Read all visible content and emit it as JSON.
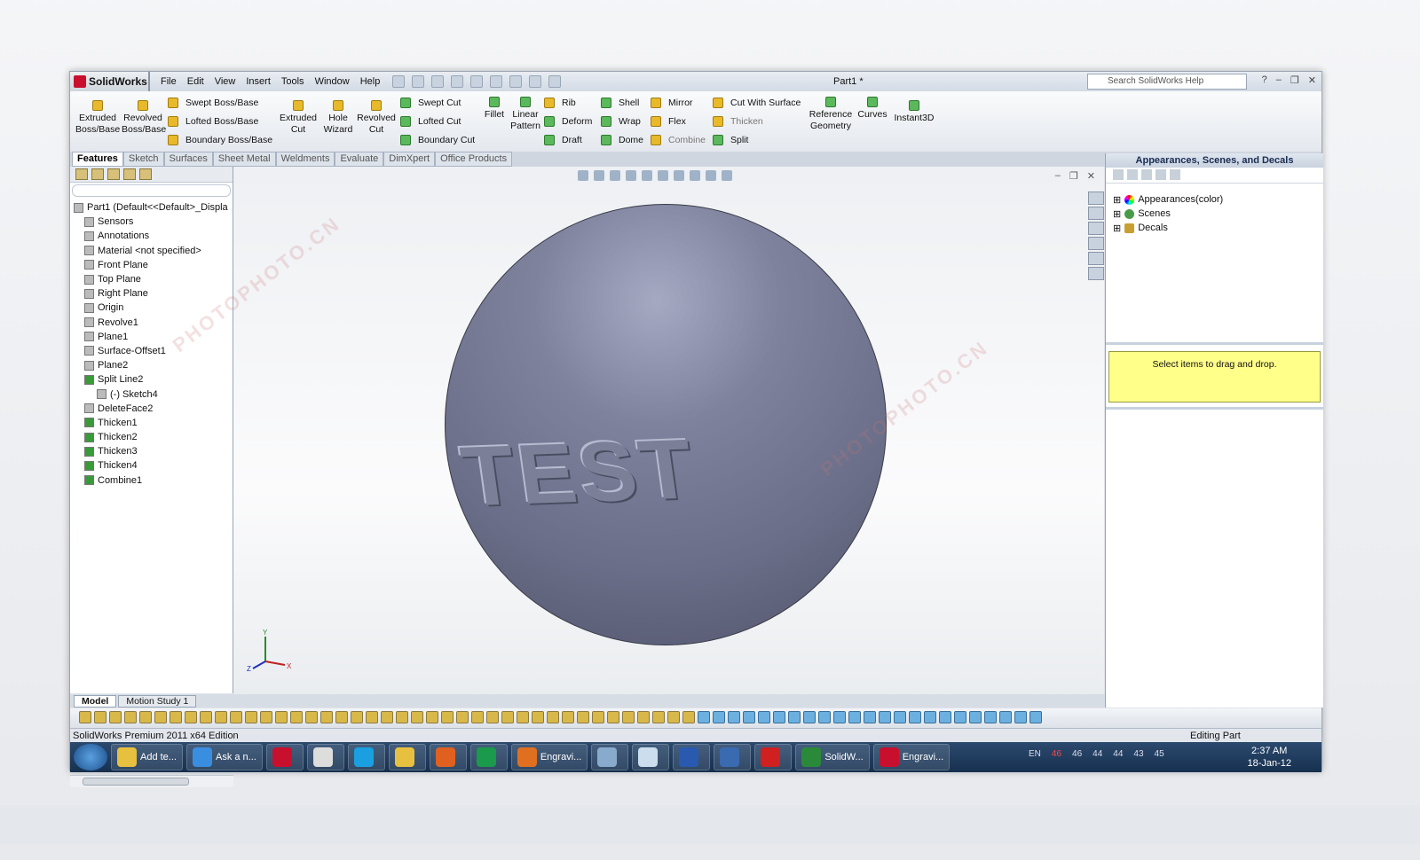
{
  "app": {
    "name": "SolidWorks",
    "title": "Part1 *",
    "search_placeholder": "Search SolidWorks Help"
  },
  "menu": [
    "File",
    "Edit",
    "View",
    "Insert",
    "Tools",
    "Window",
    "Help"
  ],
  "command_manager": {
    "big": [
      {
        "label": "Extruded Boss/Base",
        "color": "yellow"
      },
      {
        "label": "Revolved Boss/Base",
        "color": "yellow"
      },
      {
        "label": "Extruded Cut",
        "color": "yellow"
      },
      {
        "label": "Hole Wizard",
        "color": "yellow"
      },
      {
        "label": "Revolved Cut",
        "color": "yellow"
      },
      {
        "label": "Fillet",
        "color": "green"
      },
      {
        "label": "Linear Pattern",
        "color": "green"
      },
      {
        "label": "Reference Geometry",
        "color": "green"
      },
      {
        "label": "Curves",
        "color": "green"
      },
      {
        "label": "Instant3D",
        "color": "green"
      }
    ],
    "small": [
      "Swept Boss/Base",
      "Lofted Boss/Base",
      "Boundary Boss/Base",
      "Swept Cut",
      "Lofted Cut",
      "Boundary Cut",
      "Rib",
      "Deform",
      "Draft",
      "Shell",
      "Wrap",
      "Dome",
      "Mirror",
      "Flex",
      "Combine",
      "Cut With Surface",
      "Thicken",
      "Split"
    ]
  },
  "tabs": [
    "Features",
    "Sketch",
    "Surfaces",
    "Sheet Metal",
    "Weldments",
    "Evaluate",
    "DimXpert",
    "Office Products"
  ],
  "feature_tree": [
    "Part1  (Default<<Default>_Displa",
    "Sensors",
    "Annotations",
    "Material <not specified>",
    "Front Plane",
    "Top Plane",
    "Right Plane",
    "Origin",
    "Revolve1",
    "Plane1",
    "Surface-Offset1",
    "Plane2",
    "Split Line2",
    "(-) Sketch4",
    "DeleteFace2",
    "Thicken1",
    "Thicken2",
    "Thicken3",
    "Thicken4",
    "Combine1"
  ],
  "model_text": "TEST",
  "triad": {
    "x": "X",
    "y": "Y",
    "z": "Z"
  },
  "task_pane": {
    "title": "Appearances, Scenes, and Decals",
    "items": [
      "Appearances(color)",
      "Scenes",
      "Decals"
    ],
    "hint": "Select items to drag and drop."
  },
  "bottom_tabs": [
    "Model",
    "Motion Study 1"
  ],
  "status": {
    "left": "SolidWorks Premium 2011 x64 Edition",
    "right": "Editing Part"
  },
  "taskbar": {
    "buttons": [
      "Add te...",
      "Ask a n...",
      "",
      "",
      "",
      "",
      "",
      "",
      "Engravi...",
      "",
      "",
      "",
      "",
      "",
      "SolidW...",
      "Engravi..."
    ],
    "lang": "EN",
    "tray_numbers": [
      "46",
      "46",
      "44",
      "44",
      "43",
      "45"
    ],
    "time": "2:37 AM",
    "date": "18-Jan-12"
  },
  "watermark": "PHOTOPHOTO.CN"
}
